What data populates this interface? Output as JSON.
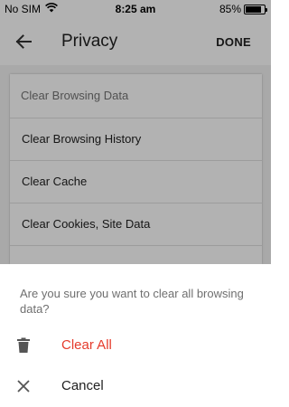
{
  "status_bar": {
    "carrier": "No SIM",
    "time": "8:25 am",
    "battery_percent": "85%",
    "battery_level": 0.85
  },
  "app_bar": {
    "back_icon": "arrow-left-icon",
    "title": "Privacy",
    "done_label": "DONE"
  },
  "card": {
    "header": "Clear Browsing Data",
    "items": [
      "Clear Browsing History",
      "Clear Cache",
      "Clear Cookies, Site Data"
    ]
  },
  "dialog": {
    "question": "Are you sure you want to clear all browsing data?",
    "actions": [
      {
        "label": "Clear All",
        "icon": "trash-icon",
        "color": "#e53b2c"
      },
      {
        "label": "Cancel",
        "icon": "close-icon",
        "color": "#212121"
      }
    ]
  }
}
